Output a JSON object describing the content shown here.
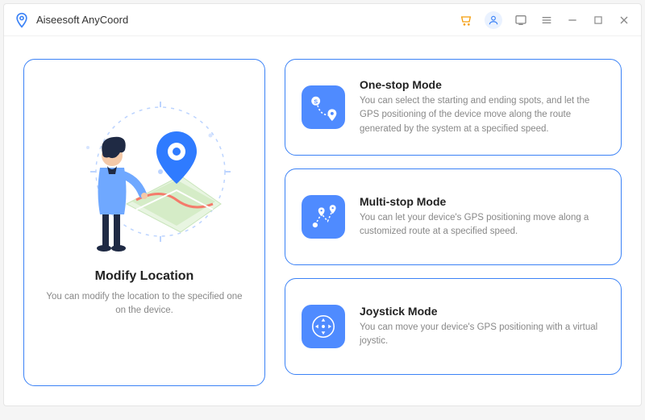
{
  "app": {
    "title": "Aiseesoft AnyCoord"
  },
  "main_card": {
    "title": "Modify Location",
    "description": "You can modify the location to the specified one on the device."
  },
  "modes": [
    {
      "icon": "one-stop-icon",
      "title": "One-stop Mode",
      "description": "You can select the starting and ending spots, and let the GPS positioning of the device move along the route generated by the system at a specified speed."
    },
    {
      "icon": "multi-stop-icon",
      "title": "Multi-stop Mode",
      "description": "You can let your device's GPS positioning move along a customized route at a specified speed."
    },
    {
      "icon": "joystick-icon",
      "title": "Joystick Mode",
      "description": "You can move your device's GPS positioning with a virtual joystic."
    }
  ]
}
